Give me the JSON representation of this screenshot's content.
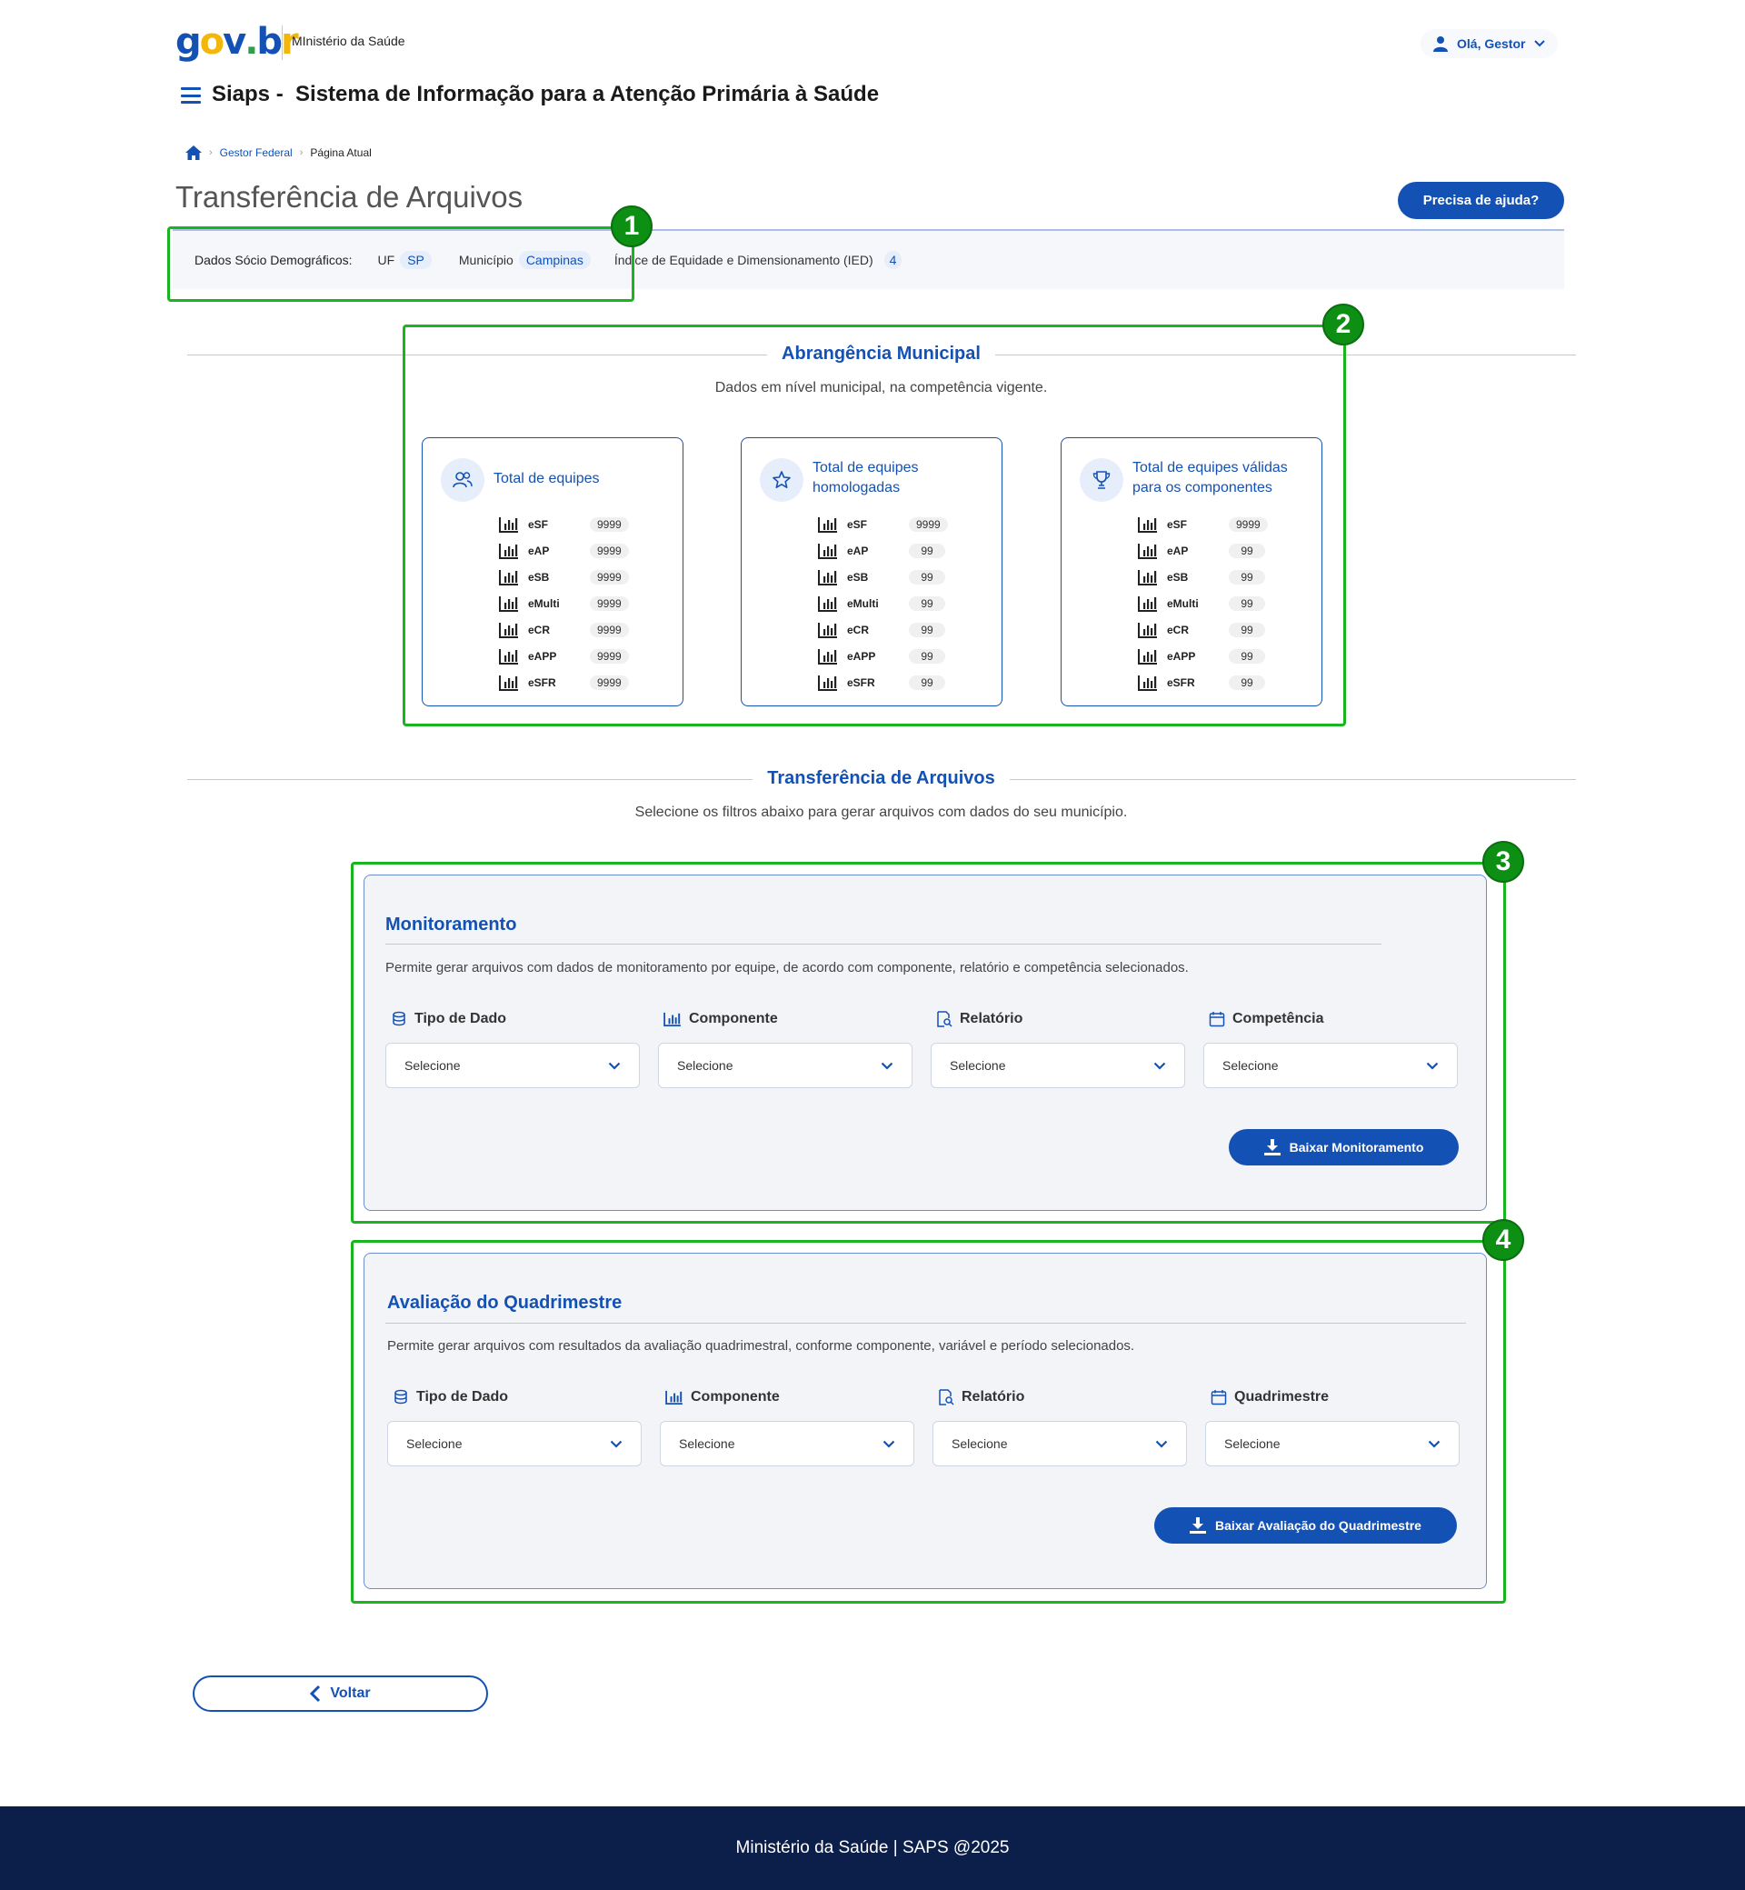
{
  "header": {
    "ministry": "MInistério da Saúde",
    "user_greeting": "Olá, Gestor",
    "app_title": "Siaps -  Sistema de Informação para a Atenção Primária à Saúde"
  },
  "breadcrumb": {
    "items": [
      "Gestor Federal",
      "Página Atual"
    ]
  },
  "page": {
    "title": "Transferência de Arquivos",
    "help_button": "Precisa de ajuda?"
  },
  "infobar": {
    "label": "Dados Sócio Demográficos:",
    "uf_label": "UF",
    "uf_value": "SP",
    "municipio_label": "Município",
    "municipio_value": "Campinas",
    "ied_label": "Índice de Equidade e Dimensionamento (IED)",
    "ied_value": "4"
  },
  "abrangencia": {
    "title": "Abrangência Municipal",
    "subtitle": "Dados em nível municipal, na competência vigente.",
    "cards": [
      {
        "icon": "people-icon",
        "title_line1": "Total de equipes",
        "title_line2": "",
        "rows": [
          {
            "name": "eSF",
            "value": "9999"
          },
          {
            "name": "eAP",
            "value": "9999"
          },
          {
            "name": "eSB",
            "value": "9999"
          },
          {
            "name": "eMulti",
            "value": "9999"
          },
          {
            "name": "eCR",
            "value": "9999"
          },
          {
            "name": "eAPP",
            "value": "9999"
          },
          {
            "name": "eSFR",
            "value": "9999"
          }
        ]
      },
      {
        "icon": "star-icon",
        "title_line1": "Total de equipes",
        "title_line2": "homologadas",
        "rows": [
          {
            "name": "eSF",
            "value": "9999"
          },
          {
            "name": "eAP",
            "value": "99"
          },
          {
            "name": "eSB",
            "value": "99"
          },
          {
            "name": "eMulti",
            "value": "99"
          },
          {
            "name": "eCR",
            "value": "99"
          },
          {
            "name": "eAPP",
            "value": "99"
          },
          {
            "name": "eSFR",
            "value": "99"
          }
        ]
      },
      {
        "icon": "trophy-icon",
        "title_line1": "Total de equipes válidas",
        "title_line2": "para os componentes",
        "rows": [
          {
            "name": "eSF",
            "value": "9999"
          },
          {
            "name": "eAP",
            "value": "99"
          },
          {
            "name": "eSB",
            "value": "99"
          },
          {
            "name": "eMulti",
            "value": "99"
          },
          {
            "name": "eCR",
            "value": "99"
          },
          {
            "name": "eAPP",
            "value": "99"
          },
          {
            "name": "eSFR",
            "value": "99"
          }
        ]
      }
    ]
  },
  "transferencia": {
    "title": "Transferência de Arquivos",
    "subtitle": "Selecione os filtros abaixo para gerar arquivos com dados do seu município."
  },
  "monitoramento": {
    "title": "Monitoramento",
    "description": "Permite gerar arquivos com dados de monitoramento por equipe, de acordo com componente, relatório e competência selecionados.",
    "fields": [
      {
        "label": "Tipo de Dado",
        "value": "Selecione"
      },
      {
        "label": "Componente",
        "value": "Selecione"
      },
      {
        "label": "Relatório",
        "value": "Selecione"
      },
      {
        "label": "Competência",
        "value": "Selecione"
      }
    ],
    "button": "Baixar Monitoramento"
  },
  "avaliacao": {
    "title": "Avaliação do Quadrimestre",
    "description": "Permite gerar arquivos com resultados da avaliação quadrimestral, conforme componente, variável e período selecionados.",
    "fields": [
      {
        "label": "Tipo de Dado",
        "value": "Selecione"
      },
      {
        "label": "Componente",
        "value": "Selecione"
      },
      {
        "label": "Relatório",
        "value": "Selecione"
      },
      {
        "label": "Quadrimestre",
        "value": "Selecione"
      }
    ],
    "button": "Baixar Avaliação do Quadrimestre"
  },
  "annotations": [
    "1",
    "2",
    "3",
    "4"
  ],
  "back_button": "Voltar",
  "footer": "Ministério da Saúde | SAPS @2025",
  "colors": {
    "primary": "#1351b4",
    "annotation": "#19b41f",
    "footer_bg": "#0c1e4a"
  }
}
